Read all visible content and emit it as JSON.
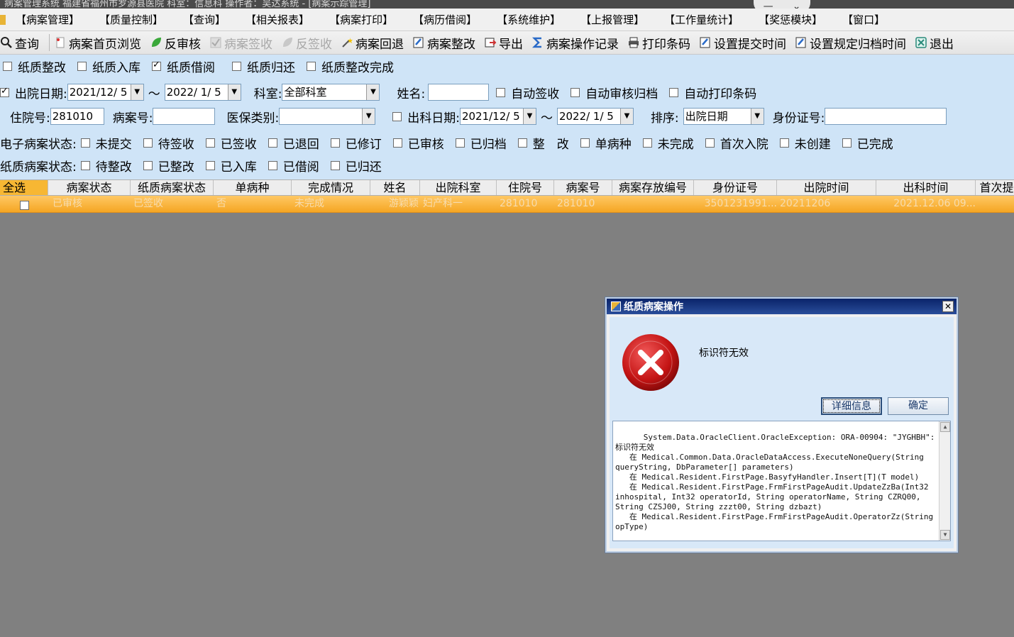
{
  "window": {
    "title": "病案管理系统  福建省福州市罗源县医院  科室：信息科  操作者：吴达系统 - [病案示踪管理]",
    "controls": [
      "—",
      "⌄"
    ]
  },
  "menu": [
    "【病案管理】",
    "【质量控制】",
    "【查询】",
    "【相关报表】",
    "【病案打印】",
    "【病历借阅】",
    "【系统维护】",
    "【上报管理】",
    "【工作量统计】",
    "【奖惩模块】",
    "【窗口】"
  ],
  "toolbar": [
    {
      "label": "查询",
      "icon": "search-icon",
      "enabled": true
    },
    {
      "label": "病案首页浏览",
      "icon": "page-icon",
      "enabled": true
    },
    {
      "label": "反审核",
      "icon": "leaf-icon",
      "enabled": true
    },
    {
      "label": "病案签收",
      "icon": "check-icon",
      "enabled": false
    },
    {
      "label": "反签收",
      "icon": "leaf-icon",
      "enabled": false
    },
    {
      "label": "病案回退",
      "icon": "wand-icon",
      "enabled": true
    },
    {
      "label": "病案整改",
      "icon": "edit-icon",
      "enabled": true
    },
    {
      "label": "导出",
      "icon": "export-icon",
      "enabled": true
    },
    {
      "label": "病案操作记录",
      "icon": "sigma-icon",
      "enabled": true
    },
    {
      "label": "打印条码",
      "icon": "printer-icon",
      "enabled": true
    },
    {
      "label": "设置提交时间",
      "icon": "edit-icon",
      "enabled": true
    },
    {
      "label": "设置规定归档时间",
      "icon": "edit-icon",
      "enabled": true
    },
    {
      "label": "退出",
      "icon": "exit-icon",
      "enabled": true
    }
  ],
  "paper_ops": [
    {
      "label": "纸质整改",
      "checked": false
    },
    {
      "label": "纸质入库",
      "checked": false
    },
    {
      "label": "纸质借阅",
      "checked": true
    },
    {
      "label": "纸质归还",
      "checked": false
    },
    {
      "label": "纸质整改完成",
      "checked": false
    }
  ],
  "filters": {
    "discharge_date_label": "出院日期:",
    "discharge_date_checked": true,
    "discharge_from": "2021/12/ 5",
    "discharge_to": "2022/ 1/ 5",
    "tilde": "～",
    "dept_label": "科室:",
    "dept_value": "全部科室",
    "name_label": "姓名:",
    "name_value": "",
    "auto_sign": "自动签收",
    "auto_audit_archive": "自动审核归档",
    "auto_print_barcode": "自动打印条码",
    "inpatient_no_label": "住院号:",
    "inpatient_no_value": "281010",
    "case_no_label": "病案号:",
    "case_no_value": "",
    "insurance_label": "医保类别:",
    "insurance_value": "",
    "dept_out_label": "出科日期:",
    "dept_out_checked": false,
    "dept_out_from": "2021/12/ 5",
    "dept_out_to": "2022/ 1/ 5",
    "sort_label": "排序:",
    "sort_value": "出院日期",
    "id_card_label": "身份证号:",
    "id_card_value": ""
  },
  "e_status": {
    "label": "电子病案状态:",
    "options": [
      "未提交",
      "待签收",
      "已签收",
      "已退回",
      "已修订",
      "已审核",
      "已归档",
      "整　改",
      "单病种",
      "未完成",
      "首次入院",
      "未创建",
      "已完成"
    ]
  },
  "paper_status": {
    "label": "纸质病案状态:",
    "options": [
      "待整改",
      "已整改",
      "已入库",
      "已借阅",
      "已归还"
    ]
  },
  "grid": {
    "columns": [
      "全选",
      "病案状态",
      "纸质病案状态",
      "单病种",
      "完成情况",
      "姓名",
      "出院科室",
      "住院号",
      "病案号",
      "病案存放编号",
      "身份证号",
      "出院时间",
      "出科时间",
      "首次提"
    ],
    "rows": [
      [
        "",
        "已审核",
        "已签收",
        "否",
        "未完成",
        "游颖颖",
        "妇产科一",
        "281010",
        "281010",
        "",
        "3501231991...",
        "20211206",
        "2021.12.06 09..."
      ]
    ]
  },
  "dialog": {
    "title": "纸质病案操作",
    "message": "标识符无效",
    "details_button": "详细信息",
    "ok_button": "确定",
    "details_text": "System.Data.OracleClient.OracleException: ORA-00904: \"JYGHBH\": 标识符无效\n   在 Medical.Common.Data.OracleDataAccess.ExecuteNoneQuery(String queryString, DbParameter[] parameters)\n   在 Medical.Resident.FirstPage.BasyfyHandler.Insert[T](T model)\n   在 Medical.Resident.FirstPage.FrmFirstPageAudit.UpdateZzBa(Int32 inhospital, Int32 operatorId, String operatorName, String CZRQ00, String CZSJ00, String zzzt00, String dzbazt)\n   在 Medical.Resident.FirstPage.FrmFirstPageAudit.OperatorZz(String opType)"
  }
}
